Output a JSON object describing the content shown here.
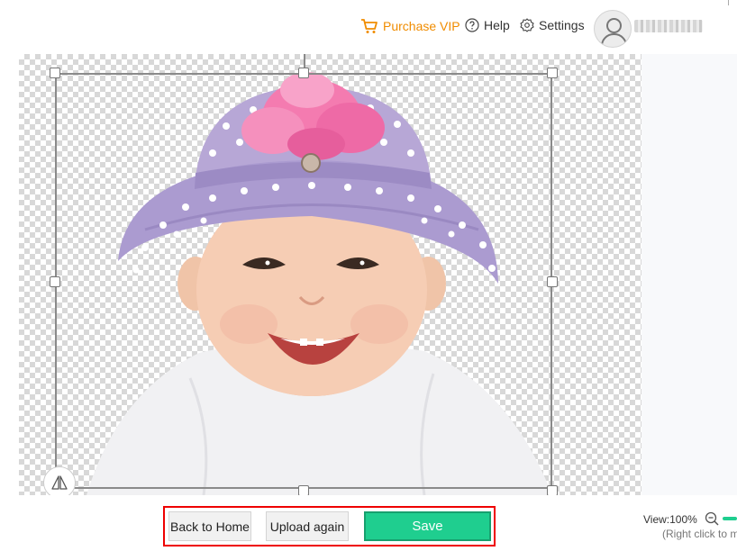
{
  "header": {
    "vip_label": "Purchase VIP",
    "help_label": "Help",
    "settings_label": "Settings",
    "colors": {
      "vip": "#f08c00"
    },
    "icons": {
      "vip": "cart-icon",
      "help": "question-circle-icon",
      "settings": "gear-icon",
      "avatar": "user-avatar-icon"
    }
  },
  "editor": {
    "icons": {
      "flip": "flip-horizontal-icon"
    }
  },
  "footer": {
    "back_label": "Back to Home",
    "upload_label": "Upload again",
    "save_label": "Save",
    "view_label": "View:100%",
    "hint": "(Right click to m",
    "colors": {
      "save": "#1fce8f",
      "highlight_border": "#e00000"
    },
    "icons": {
      "zoom_out": "zoom-out-icon"
    }
  }
}
